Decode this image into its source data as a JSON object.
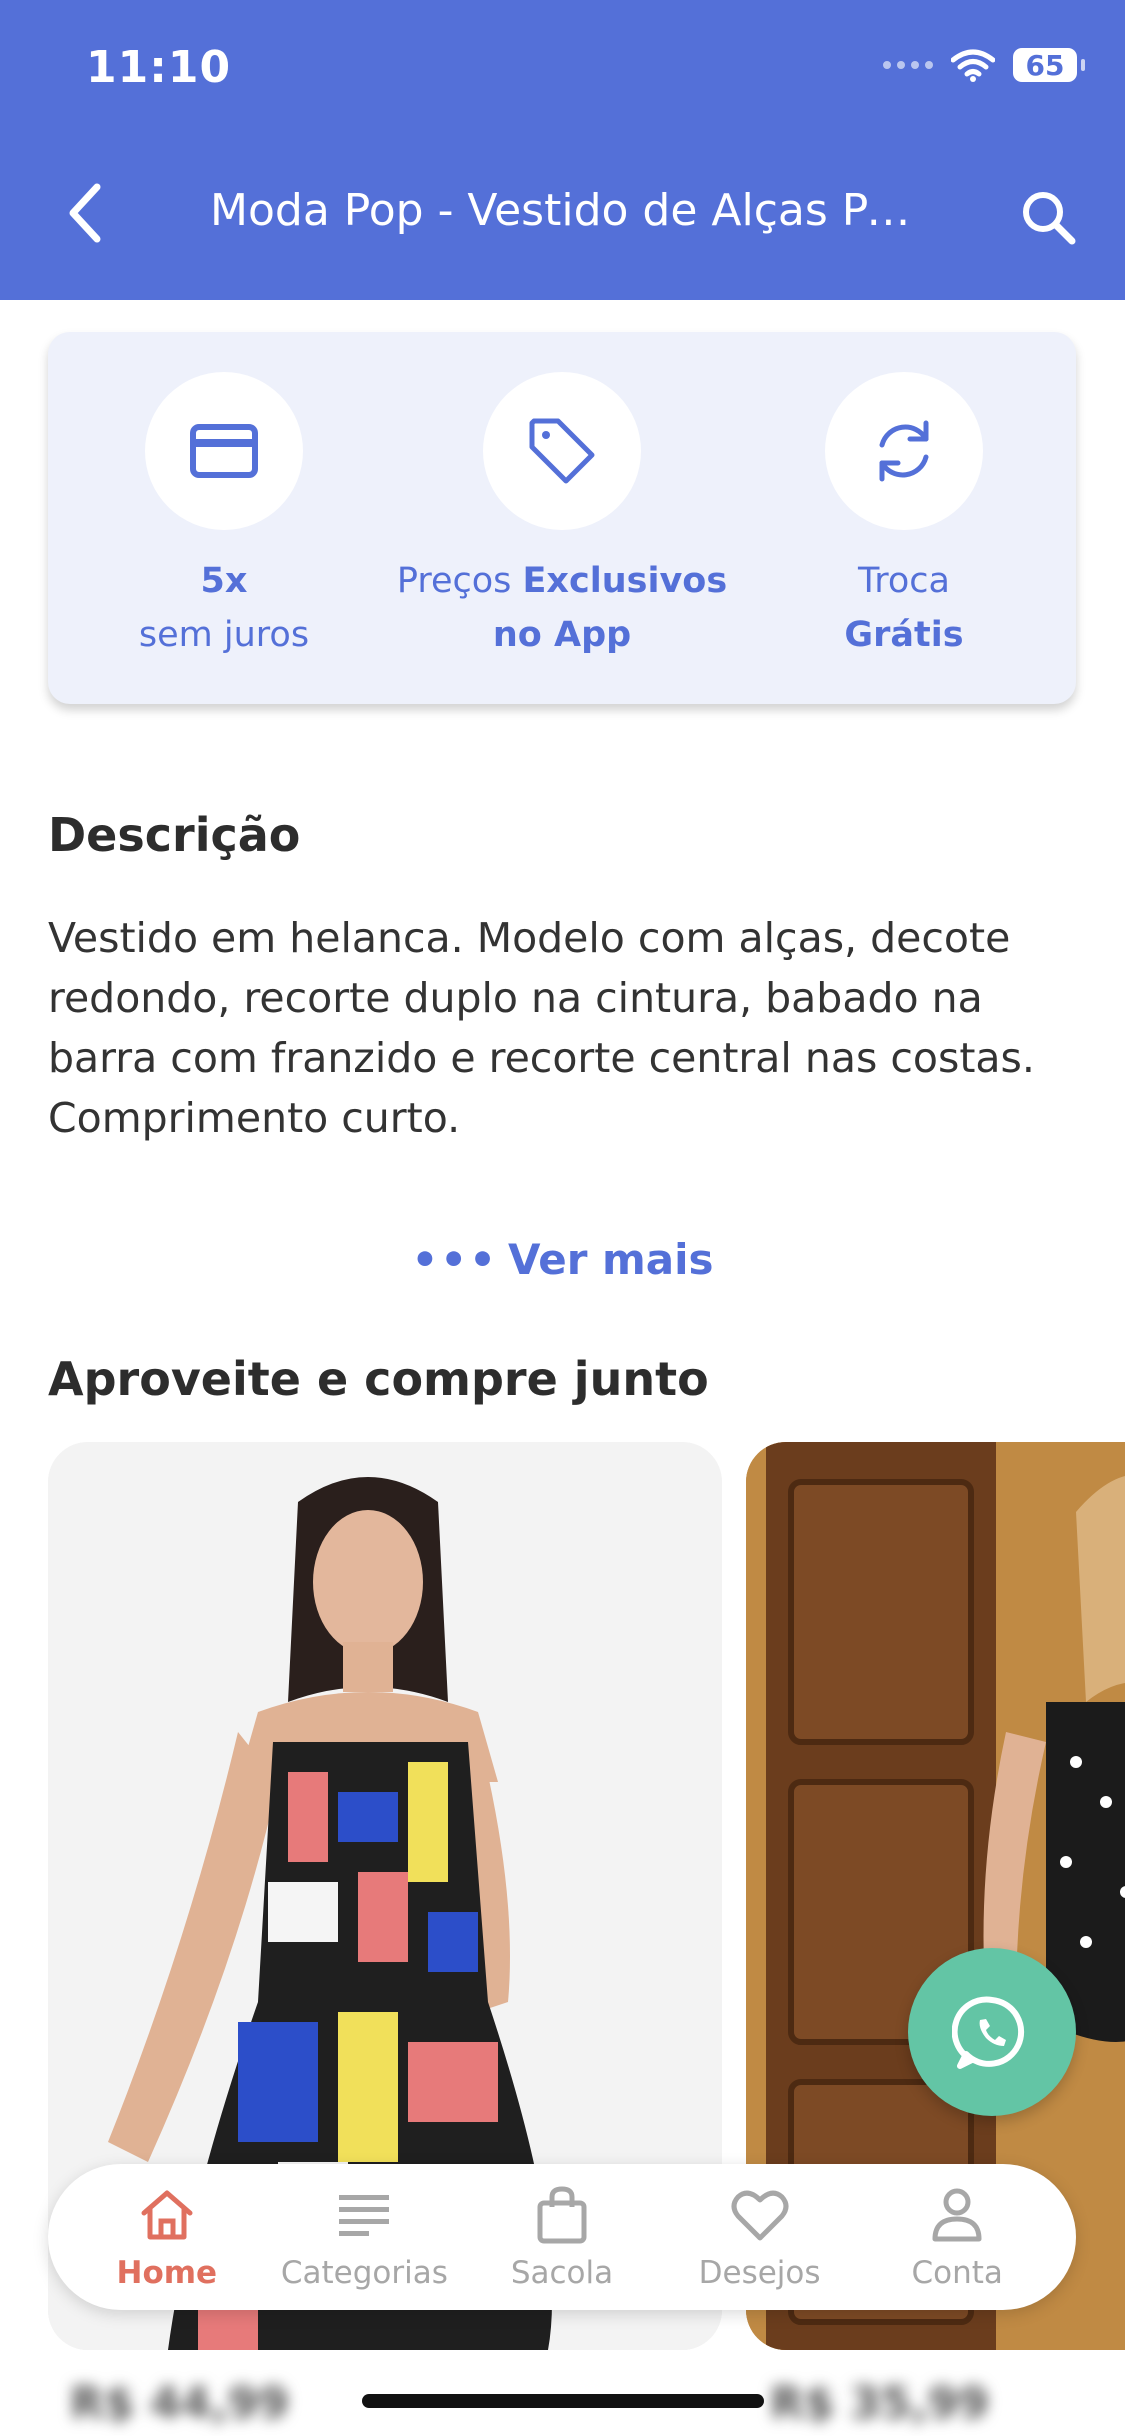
{
  "status": {
    "time": "11:10",
    "battery": "65"
  },
  "header": {
    "title": "Moda Pop - Vestido de Alças Pai..."
  },
  "benefits": [
    {
      "icon": "credit-card-icon",
      "line1_bold": "5x",
      "line2": "sem juros"
    },
    {
      "icon": "price-tag-icon",
      "line1": "Preços ",
      "line1_bold": "Exclusivos",
      "line2_bold": "no App"
    },
    {
      "icon": "exchange-icon",
      "line1": "Troca",
      "line2_bold": "Grátis"
    }
  ],
  "description": {
    "title": "Descrição",
    "body": "Vestido em helanca. Modelo com alças, decote redondo, recorte duplo na cintura, babado na barra com franzido e recorte central nas costas. Comprimento curto."
  },
  "ver_mais": {
    "dots": "•••",
    "label": "Ver mais"
  },
  "related": {
    "title": "Aproveite e compre junto",
    "products": [
      {
        "price": "R$ 44,99"
      },
      {
        "price": "R$ 35,99"
      }
    ]
  },
  "tabbar": {
    "items": [
      {
        "label": "Home",
        "icon": "home-icon",
        "active": true
      },
      {
        "label": "Categorias",
        "icon": "list-icon",
        "active": false
      },
      {
        "label": "Sacola",
        "icon": "bag-icon",
        "active": false
      },
      {
        "label": "Desejos",
        "icon": "heart-icon",
        "active": false
      },
      {
        "label": "Conta",
        "icon": "user-icon",
        "active": false
      }
    ]
  },
  "colors": {
    "brand": "#5470d8",
    "active_tab": "#e0705f",
    "whatsapp": "#63c5a5"
  }
}
